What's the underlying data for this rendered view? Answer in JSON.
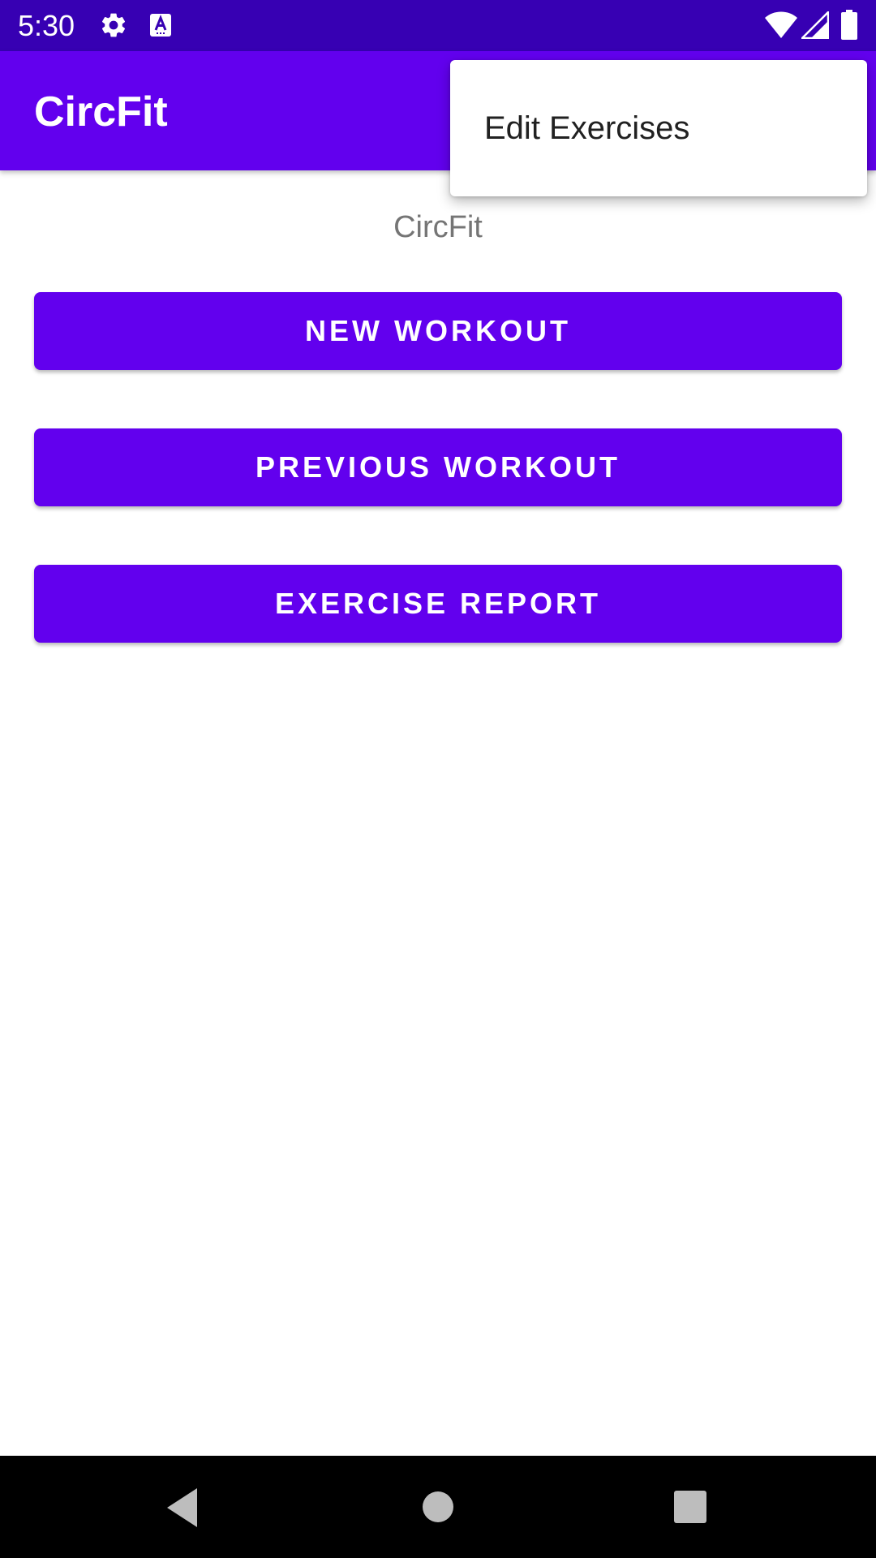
{
  "status_bar": {
    "time": "5:30",
    "background_color": "#3700b3",
    "icons": [
      "gear-icon",
      "keyboard-a-icon",
      "wifi-icon",
      "cell-signal-icon",
      "battery-icon"
    ]
  },
  "app_bar": {
    "title": "CircFit",
    "background_color": "#6200ee"
  },
  "main": {
    "heading": "CircFit",
    "buttons": [
      {
        "label": "NEW WORKOUT"
      },
      {
        "label": "PREVIOUS WORKOUT"
      },
      {
        "label": "EXERCISE REPORT"
      }
    ],
    "button_color": "#6200ee"
  },
  "overflow_menu": {
    "items": [
      {
        "label": "Edit Exercises"
      }
    ]
  },
  "nav_bar": {
    "icons": [
      "back-icon",
      "home-icon",
      "recents-icon"
    ]
  }
}
